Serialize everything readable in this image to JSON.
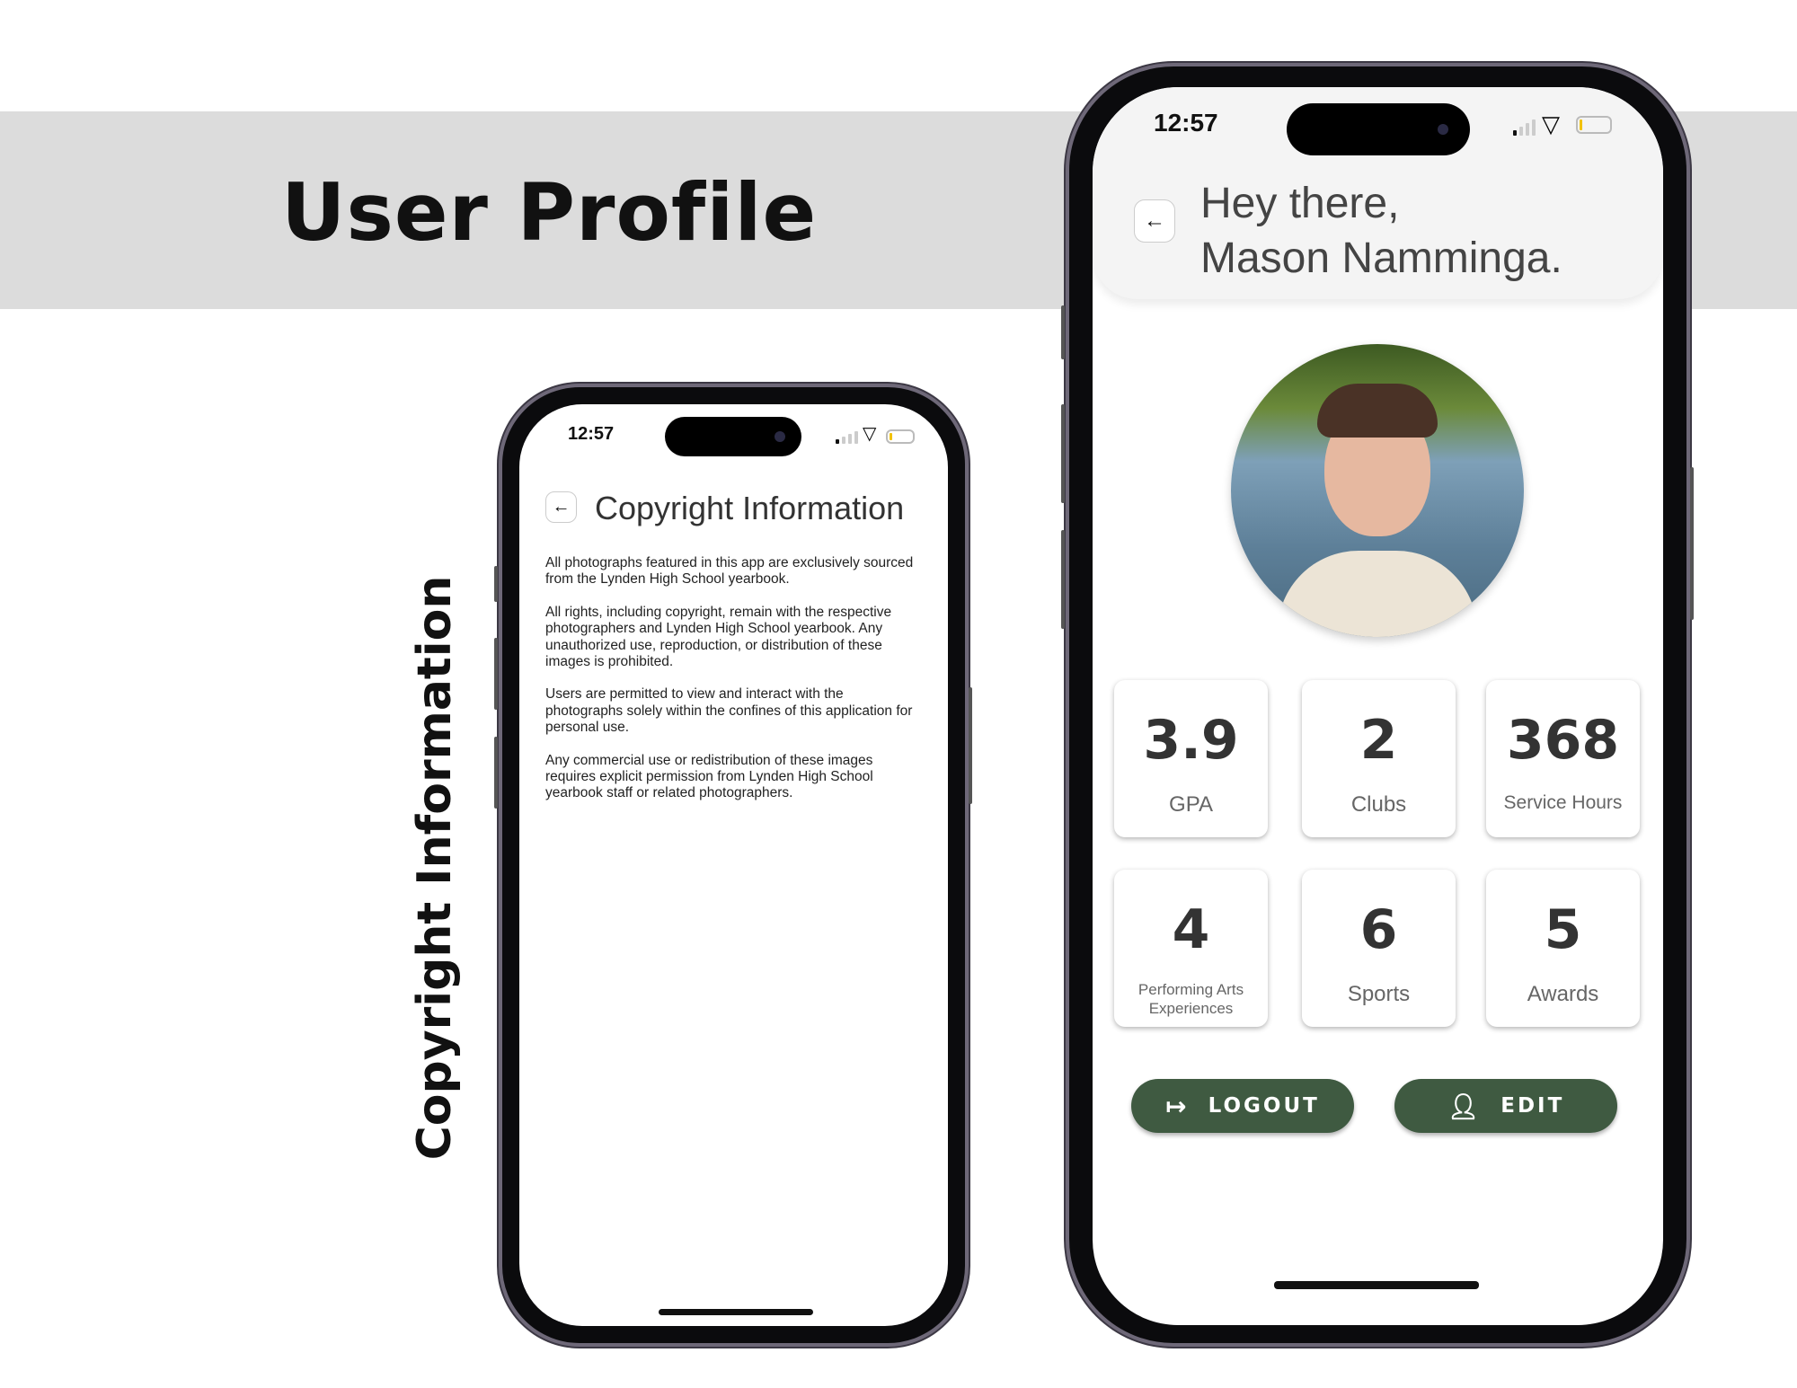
{
  "page": {
    "title": "User Profile",
    "side_title": "Copyright Information"
  },
  "copyright_screen": {
    "status_time": "12:57",
    "title": "Copyright Information",
    "back_icon": "arrow-left-icon",
    "paragraphs": [
      "All photographs featured in this app are exclusively sourced from the Lynden High School yearbook.",
      "All rights, including copyright, remain with the respective photographers and Lynden High School yearbook. Any unauthorized use, reproduction, or distribution of these images is prohibited.",
      "Users are permitted to view and interact with the photographs solely within the confines of this application for personal use.",
      "Any commercial use or redistribution of these images requires explicit permission from Lynden High School yearbook staff or related photographers."
    ]
  },
  "profile_screen": {
    "status_time": "12:57",
    "greeting_line1": "Hey there,",
    "greeting_line2": "Mason Namminga.",
    "back_icon": "arrow-left-icon",
    "stats": [
      {
        "value": "3.9",
        "label": "GPA"
      },
      {
        "value": "2",
        "label": "Clubs"
      },
      {
        "value": "368",
        "label": "Service Hours"
      },
      {
        "value": "4",
        "label": "Performing Arts Experiences"
      },
      {
        "value": "6",
        "label": "Sports"
      },
      {
        "value": "5",
        "label": "Awards"
      }
    ],
    "logout_label": "LOGOUT",
    "edit_label": "EDIT",
    "button_color": "#3f5a41"
  }
}
